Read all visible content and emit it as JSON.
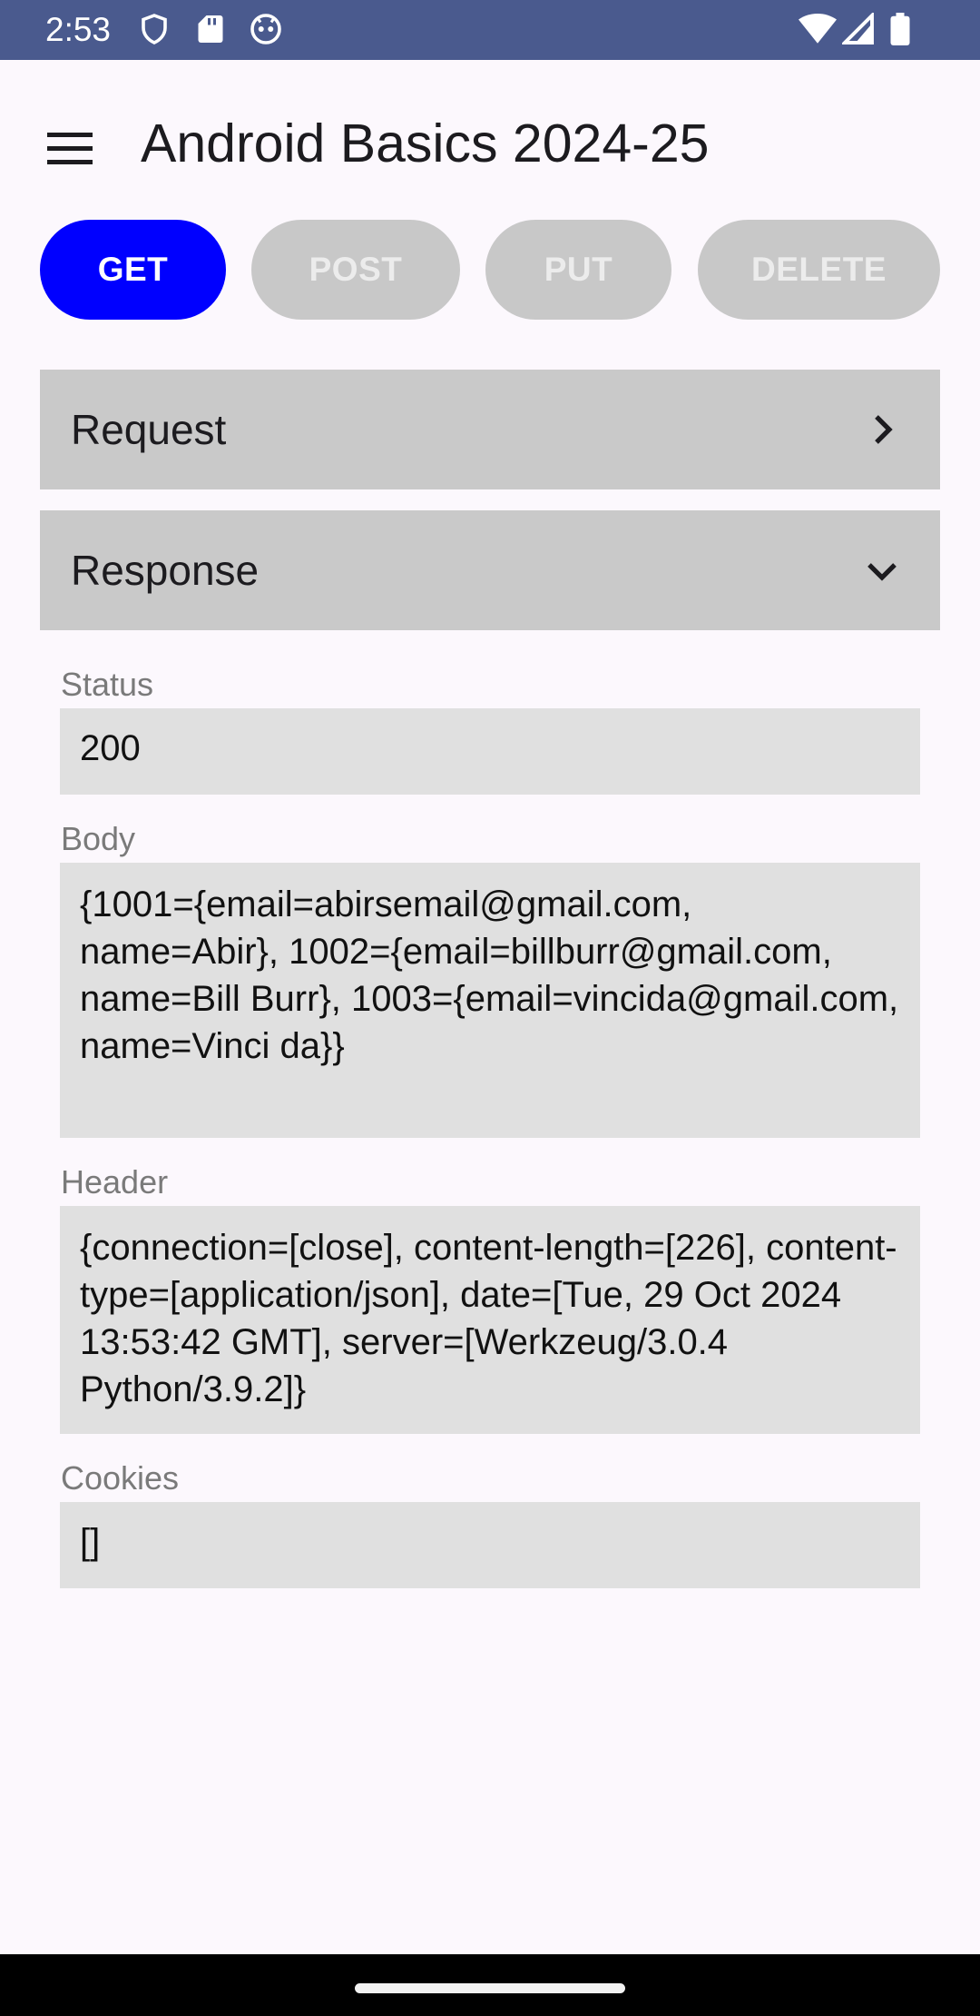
{
  "status_bar": {
    "time": "2:53",
    "icons_left": [
      "shield-icon",
      "sd-card-icon",
      "robot-icon"
    ],
    "icons_right": [
      "wifi-icon",
      "signal-icon",
      "battery-icon"
    ]
  },
  "app_bar": {
    "title": "Android Basics 2024-25"
  },
  "methods": [
    {
      "label": "GET",
      "active": true
    },
    {
      "label": "POST",
      "active": false
    },
    {
      "label": "PUT",
      "active": false
    },
    {
      "label": "DELETE",
      "active": false
    }
  ],
  "sections": {
    "request": {
      "label": "Request",
      "expanded": false
    },
    "response": {
      "label": "Response",
      "expanded": true
    }
  },
  "response": {
    "status_label": "Status",
    "status_value": "200",
    "body_label": "Body",
    "body_value": "{1001={email=abirsemail@gmail.com, name=Abir}, 1002={email=billburr@gmail.com, name=Bill Burr}, 1003={email=vincida@gmail.com, name=Vinci da}}",
    "header_label": "Header",
    "header_value": "{connection=[close], content-length=[226], content-type=[application/json], date=[Tue, 29 Oct 2024 13:53:42 GMT], server=[Werkzeug/3.0.4 Python/3.9.2]}",
    "cookies_label": "Cookies",
    "cookies_value": "[]"
  },
  "colors": {
    "status_bar": "#4a5a8e",
    "active_method": "#0000ff",
    "inactive_method": "#c8c8c8",
    "section_bg": "#c9c9c9",
    "field_bg": "#e0e0e0"
  }
}
